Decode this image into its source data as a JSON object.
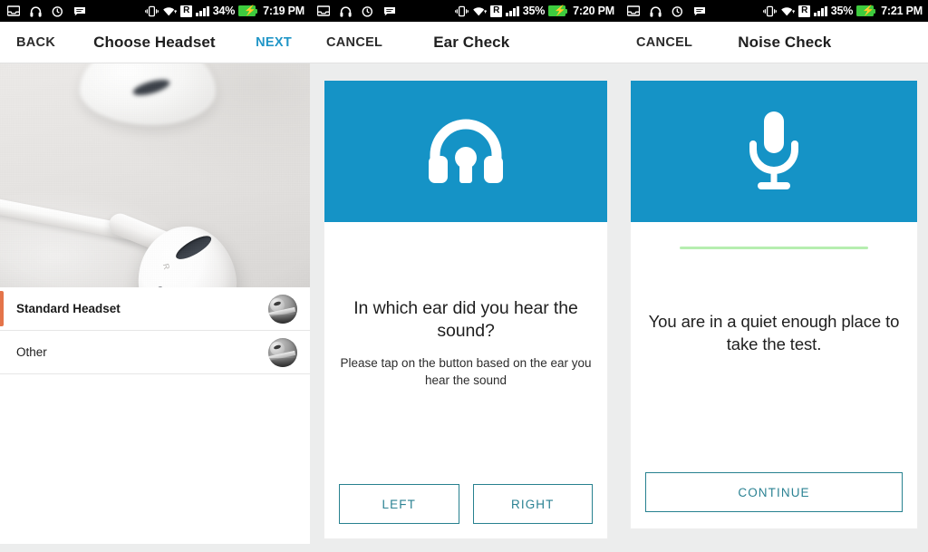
{
  "panels": [
    {
      "status": {
        "icons": [
          "inbox-icon",
          "headphones-icon",
          "headphone-sync-icon",
          "message-icon"
        ],
        "vibrate": "vibrate-icon",
        "wifi": "wifi-icon",
        "roaming": "R",
        "signal": "signal-bars-icon",
        "battery_pct": "34%",
        "battery": "battery-charging-icon",
        "time": "7:19 PM"
      },
      "appbar": {
        "left_action": "BACK",
        "title": "Choose Headset",
        "right_action": "NEXT"
      },
      "photo_alt": "earbuds-photo",
      "list": [
        {
          "label": "Standard Headset",
          "selected": true,
          "thumb": "headset-thumbnail"
        },
        {
          "label": "Other",
          "selected": false,
          "thumb": "headset-thumbnail"
        }
      ]
    },
    {
      "status": {
        "icons": [
          "inbox-icon",
          "headphones-icon",
          "headphone-sync-icon",
          "message-icon"
        ],
        "vibrate": "vibrate-icon",
        "wifi": "wifi-icon",
        "roaming": "R",
        "signal": "signal-bars-icon",
        "battery_pct": "35%",
        "battery": "battery-charging-icon",
        "time": "7:20 PM"
      },
      "appbar": {
        "left_action": "CANCEL",
        "title": "Ear Check"
      },
      "banner_icon": "headphones-icon",
      "question": "In which ear did you hear the sound?",
      "instruction": "Please tap on the button based on the ear you hear the sound",
      "buttons": [
        {
          "label": "LEFT"
        },
        {
          "label": "RIGHT"
        }
      ]
    },
    {
      "status": {
        "icons": [
          "inbox-icon",
          "headphones-icon",
          "headphone-sync-icon",
          "message-icon"
        ],
        "vibrate": "vibrate-icon",
        "wifi": "wifi-icon",
        "roaming": "R",
        "signal": "signal-bars-icon",
        "battery_pct": "35%",
        "battery": "battery-charging-icon",
        "time": "7:21 PM"
      },
      "appbar": {
        "left_action": "CANCEL",
        "title": "Noise Check"
      },
      "banner_icon": "microphone-icon",
      "noise_meter": "noise-level-indicator",
      "message": "You are in a quiet enough place to take the test.",
      "buttons": [
        {
          "label": "CONTINUE"
        }
      ]
    }
  ],
  "colors": {
    "banner_blue": "#1593c6",
    "accent_orange": "#e4744a",
    "button_teal": "#2b8293",
    "meter_green": "#b6eeb0",
    "next_blue": "#2196c7",
    "statusbar_black": "#000000",
    "battery_green": "#3ecb3e",
    "page_gray": "#eceded"
  }
}
